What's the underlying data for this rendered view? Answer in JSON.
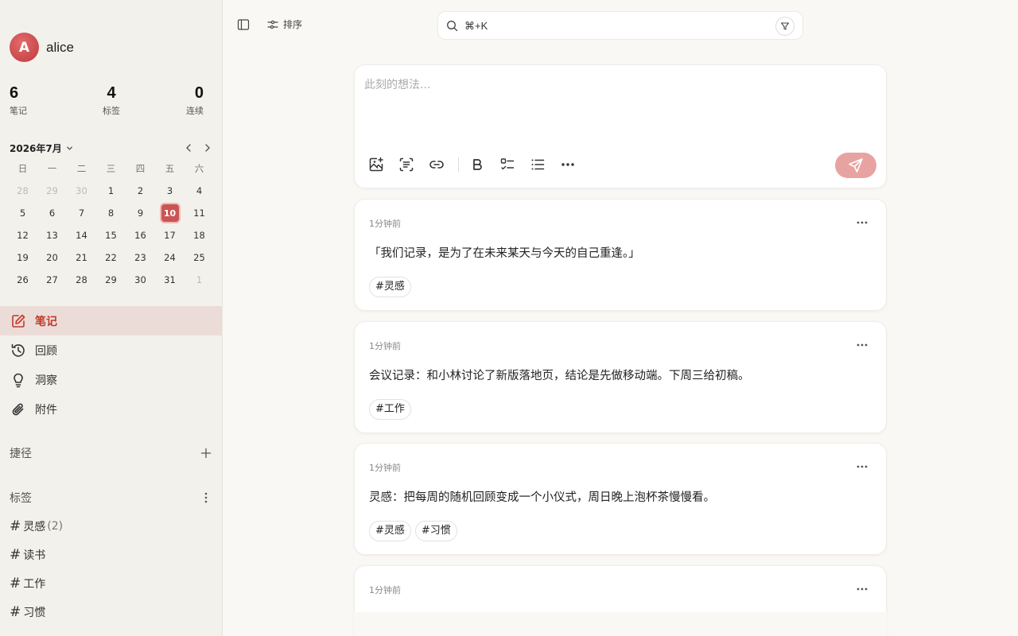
{
  "user": {
    "avatar_letter": "A",
    "name": "alice"
  },
  "stats": [
    {
      "value": "6",
      "label": "笔记"
    },
    {
      "value": "4",
      "label": "标签"
    },
    {
      "value": "0",
      "label": "连续"
    }
  ],
  "calendar": {
    "month_label": "2026年7月",
    "weekdays": [
      "日",
      "一",
      "二",
      "三",
      "四",
      "五",
      "六"
    ],
    "weeks": [
      [
        {
          "d": "28",
          "dim": true
        },
        {
          "d": "29",
          "dim": true
        },
        {
          "d": "30",
          "dim": true
        },
        {
          "d": "1"
        },
        {
          "d": "2"
        },
        {
          "d": "3"
        },
        {
          "d": "4"
        }
      ],
      [
        {
          "d": "5"
        },
        {
          "d": "6"
        },
        {
          "d": "7"
        },
        {
          "d": "8"
        },
        {
          "d": "9"
        },
        {
          "d": "10",
          "today": true
        },
        {
          "d": "11"
        }
      ],
      [
        {
          "d": "12"
        },
        {
          "d": "13"
        },
        {
          "d": "14"
        },
        {
          "d": "15"
        },
        {
          "d": "16"
        },
        {
          "d": "17"
        },
        {
          "d": "18"
        }
      ],
      [
        {
          "d": "19"
        },
        {
          "d": "20"
        },
        {
          "d": "21"
        },
        {
          "d": "22"
        },
        {
          "d": "23"
        },
        {
          "d": "24"
        },
        {
          "d": "25"
        }
      ],
      [
        {
          "d": "26"
        },
        {
          "d": "27"
        },
        {
          "d": "28"
        },
        {
          "d": "29"
        },
        {
          "d": "30"
        },
        {
          "d": "31"
        },
        {
          "d": "1",
          "dim": true
        }
      ]
    ]
  },
  "nav": [
    {
      "label": "笔记",
      "icon": "edit-icon",
      "active": true
    },
    {
      "label": "回顾",
      "icon": "history-icon"
    },
    {
      "label": "洞察",
      "icon": "lightbulb-icon"
    },
    {
      "label": "附件",
      "icon": "paperclip-icon"
    }
  ],
  "shortcuts": {
    "title": "捷径"
  },
  "tags_section": {
    "title": "标签",
    "items": [
      {
        "name": "灵感",
        "count": "(2)"
      },
      {
        "name": "读书",
        "count": ""
      },
      {
        "name": "工作",
        "count": ""
      },
      {
        "name": "习惯",
        "count": ""
      }
    ]
  },
  "topbar": {
    "sort_label": "排序",
    "search_placeholder": "⌘+K"
  },
  "editor": {
    "placeholder": "此刻的想法..."
  },
  "memos": [
    {
      "time": "1分钟前",
      "content": "「我们记录，是为了在未来某天与今天的自己重逢。」",
      "tags": [
        "#灵感"
      ]
    },
    {
      "time": "1分钟前",
      "content": "会议记录：和小林讨论了新版落地页，结论是先做移动端。下周三给初稿。",
      "tags": [
        "#工作"
      ]
    },
    {
      "time": "1分钟前",
      "content": "灵感：把每周的随机回顾变成一个小仪式，周日晚上泡杯茶慢慢看。",
      "tags": [
        "#灵感",
        "#习惯"
      ]
    },
    {
      "time": "1分钟前",
      "content": "",
      "tags": []
    }
  ],
  "colors": {
    "accent": "#c95555",
    "send_button": "#e7a3a2",
    "sidebar_bg": "#f3f1ec",
    "active_nav_bg": "#ecdcd7"
  }
}
